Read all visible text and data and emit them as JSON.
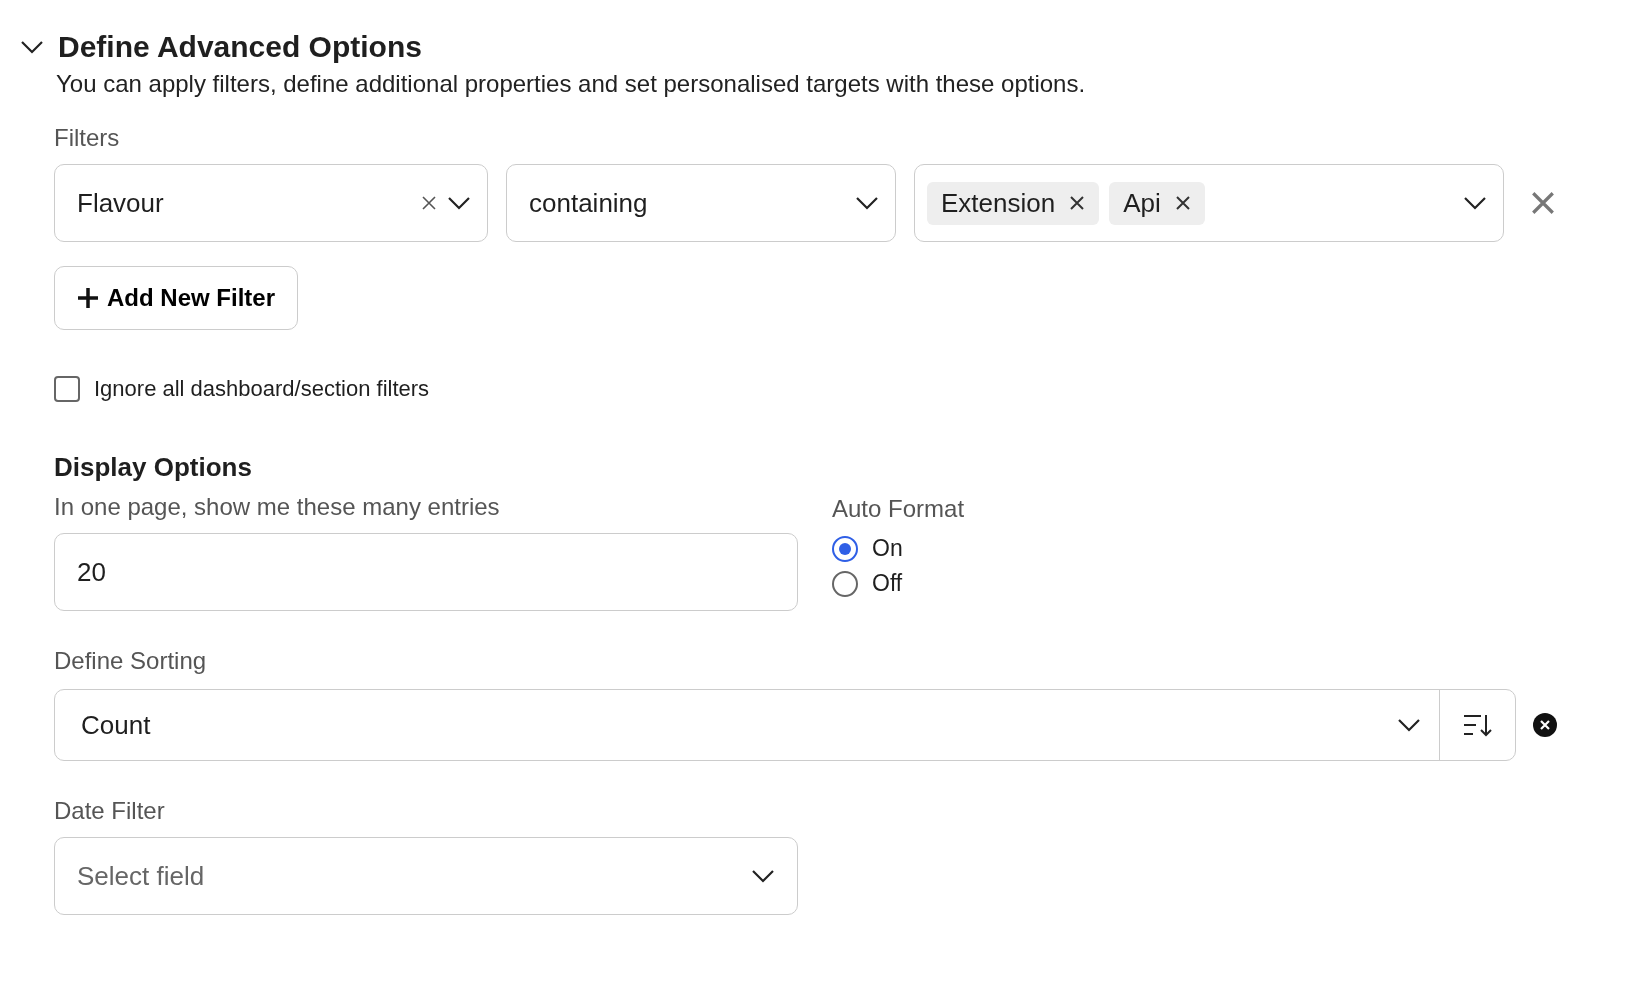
{
  "section": {
    "title": "Define Advanced Options",
    "expanded": true,
    "description": "You can apply filters, define additional properties and set personalised targets with these options."
  },
  "filters": {
    "label": "Filters",
    "rows": [
      {
        "field": "Flavour",
        "operator": "containing",
        "values": [
          "Extension",
          "Api"
        ]
      }
    ],
    "add_button": "Add New Filter"
  },
  "ignore_filters": {
    "label": "Ignore all dashboard/section filters",
    "checked": false
  },
  "display_options": {
    "title": "Display Options",
    "entries_label": "In one page, show me these many entries",
    "entries_value": "20",
    "auto_format": {
      "label": "Auto Format",
      "options": [
        {
          "label": "On",
          "selected": true
        },
        {
          "label": "Off",
          "selected": false
        }
      ]
    }
  },
  "sorting": {
    "label": "Define Sorting",
    "value": "Count"
  },
  "date_filter": {
    "label": "Date Filter",
    "placeholder": "Select field"
  }
}
